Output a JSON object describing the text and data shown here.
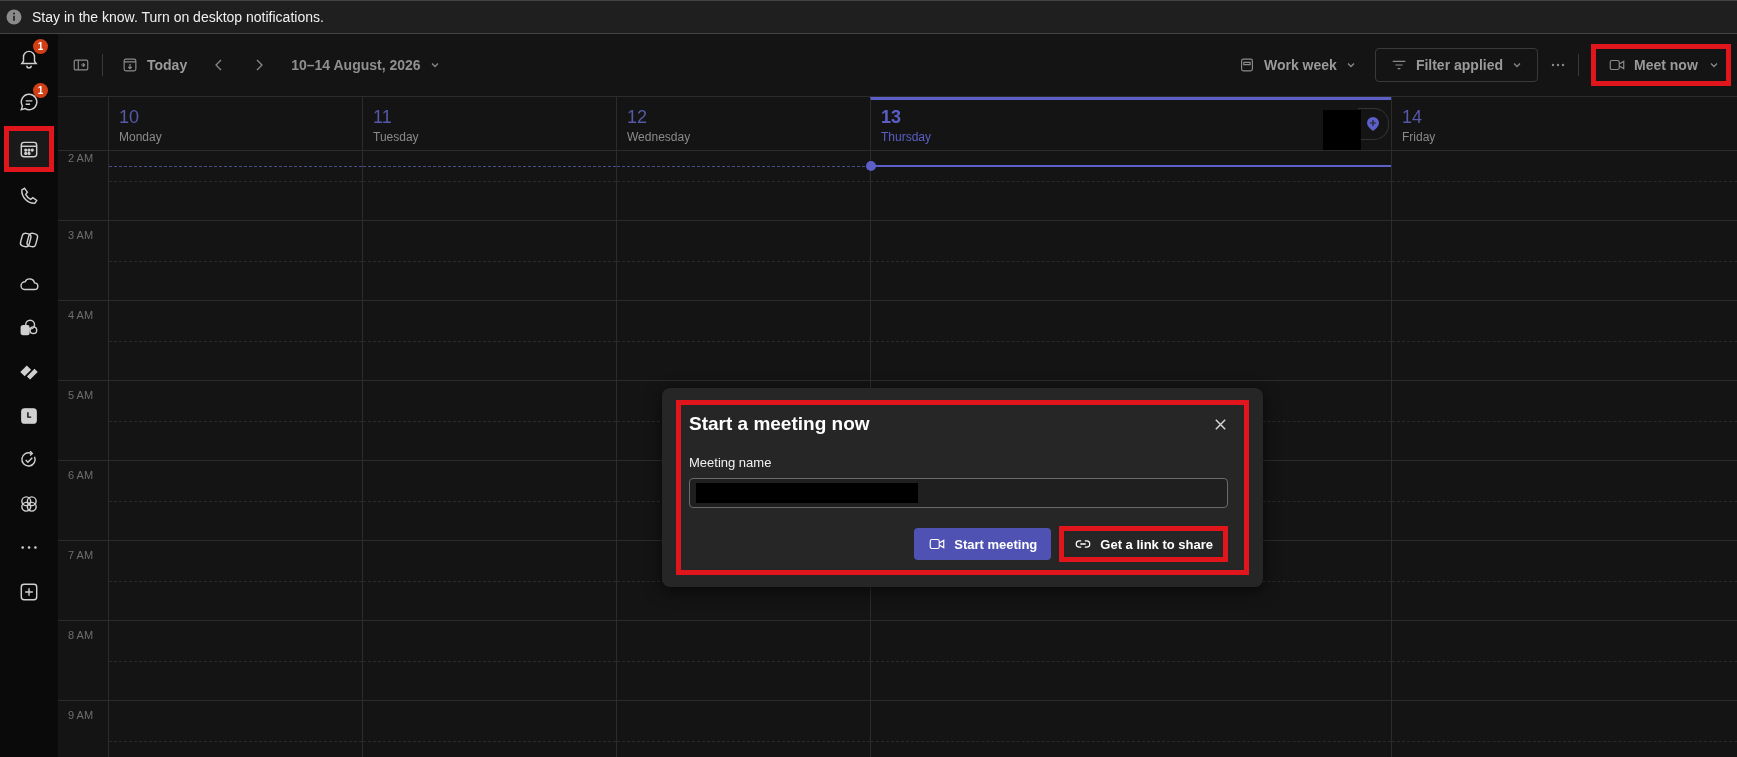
{
  "banner": {
    "text": "Stay in the know. Turn on desktop notifications."
  },
  "sidebar": {
    "items": [
      {
        "badge": "1",
        "selected": false,
        "highlighted": false
      },
      {
        "badge": "1",
        "selected": false,
        "highlighted": false
      },
      {
        "selected": true,
        "highlighted": true
      },
      {
        "selected": false,
        "highlighted": false
      },
      {
        "selected": false,
        "highlighted": false
      },
      {
        "selected": false,
        "highlighted": false
      },
      {
        "selected": false,
        "highlighted": false
      },
      {
        "selected": false,
        "highlighted": false
      },
      {
        "selected": false,
        "highlighted": false
      },
      {
        "selected": false,
        "highlighted": false
      },
      {
        "selected": false,
        "highlighted": false
      },
      {
        "selected": false,
        "highlighted": false
      },
      {
        "selected": false,
        "highlighted": false
      }
    ]
  },
  "toolbar": {
    "today": "Today",
    "date_range": "10–14 August, 2026",
    "view": "Work week",
    "filter": "Filter applied",
    "meet_now": {
      "label": "Meet now",
      "highlighted": true
    }
  },
  "days": [
    {
      "number": "10",
      "name": "Monday",
      "selected": false
    },
    {
      "number": "11",
      "name": "Tuesday",
      "selected": false
    },
    {
      "number": "12",
      "name": "Wednesday",
      "selected": false
    },
    {
      "number": "13",
      "name": "Thursday",
      "selected": true
    },
    {
      "number": "14",
      "name": "Friday",
      "selected": false
    }
  ],
  "times": [
    "2 AM",
    "3 AM",
    "4 AM",
    "5 AM",
    "6 AM",
    "7 AM",
    "8 AM",
    "9 AM"
  ],
  "dialog": {
    "title": "Start a meeting now",
    "highlighted": true,
    "field_label": "Meeting name",
    "start_button": "Start meeting",
    "link_button": {
      "label": "Get a link to share",
      "highlighted": true
    }
  }
}
